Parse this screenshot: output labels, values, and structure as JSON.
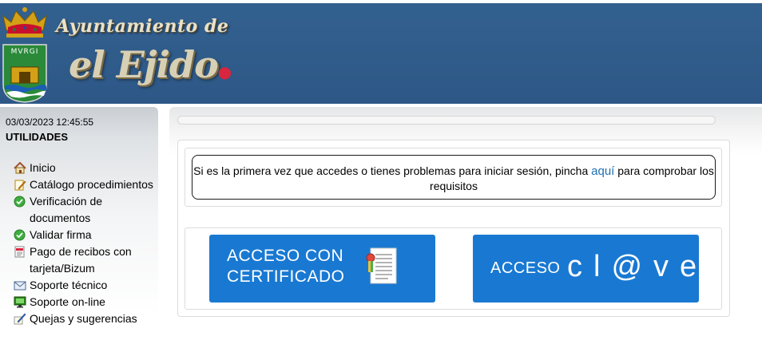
{
  "header": {
    "crest_text": "MVRGI",
    "org_title": "Ayuntamiento de",
    "city_name": "el Ejido"
  },
  "sidebar": {
    "datetime": "03/03/2023 12:45:55",
    "section_title": "UTILIDADES",
    "items": [
      {
        "label": "Inicio",
        "icon": "home-icon"
      },
      {
        "label": "Catálogo procedimientos",
        "icon": "pencil-document-icon"
      },
      {
        "label": "Verificación de documentos",
        "icon": "check-circle-icon"
      },
      {
        "label": "Validar firma",
        "icon": "check-circle-icon"
      },
      {
        "label": "Pago de recibos con tarjeta/Bizum",
        "icon": "receipt-icon"
      },
      {
        "label": "Soporte técnico",
        "icon": "mail-icon"
      },
      {
        "label": "Soporte on-line",
        "icon": "monitor-icon"
      },
      {
        "label": "Quejas y sugerencias",
        "icon": "quill-icon"
      }
    ]
  },
  "notice": {
    "text_before": "Si es la primera vez que accedes o tienes problemas para iniciar sesión, pincha ",
    "link_text": "aquí",
    "text_after": " para comprobar los requisitos"
  },
  "access": {
    "certificate_line1": "ACCESO CON",
    "certificate_line2": "CERTIFICADO",
    "clave_prefix": "ACCESO",
    "clave_word": "cl@ve"
  },
  "colors": {
    "header_bg": "#2f5a8c",
    "button_bg": "#1979d2",
    "link": "#1f6fb5"
  }
}
